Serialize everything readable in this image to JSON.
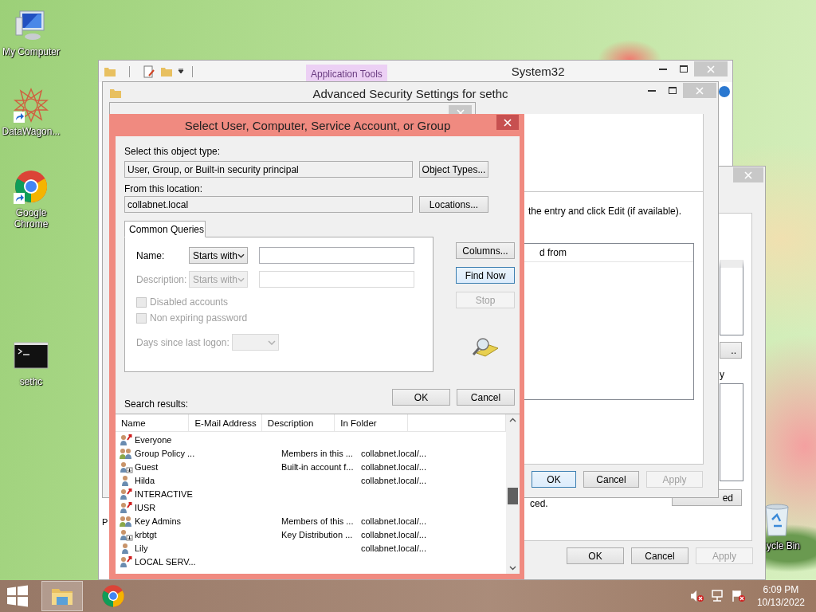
{
  "desktop_icons": [
    {
      "kind": "computer",
      "label": "My Computer",
      "shortcut": false
    },
    {
      "kind": "star",
      "label": "DataWagon...",
      "shortcut": true
    },
    {
      "kind": "chrome",
      "label": "Google Chrome",
      "shortcut": true
    },
    {
      "kind": "console",
      "label": "sethc",
      "shortcut": false
    }
  ],
  "recycle_bin": {
    "label": "ycle Bin"
  },
  "explorer_window": {
    "title": "System32",
    "context_tab": "Application Tools",
    "pane_fragment": "P"
  },
  "advanced_security_window": {
    "title": "Advanced Security Settings for sethc",
    "instruction": "the entry and click Edit (if available).",
    "list_header": "d from",
    "buttons": [
      {
        "label": "OK",
        "default": true,
        "disabled": false
      },
      {
        "label": "Cancel",
        "default": false,
        "disabled": false
      },
      {
        "label": "Apply",
        "default": false,
        "disabled": true
      }
    ]
  },
  "properties_window": {
    "label_fragment": "y",
    "small_button": "..",
    "note": "ced.",
    "advanced_button": "ed",
    "buttons": [
      {
        "label": "OK",
        "default": false,
        "disabled": false
      },
      {
        "label": "Cancel",
        "default": false,
        "disabled": false
      },
      {
        "label": "Apply",
        "default": false,
        "disabled": true
      }
    ]
  },
  "select_dialog": {
    "title": "Select User, Computer, Service Account, or Group",
    "object_type": {
      "label": "Select this object type:",
      "value": "User, Group, or Built-in security principal",
      "button": "Object Types..."
    },
    "location": {
      "label": "From this location:",
      "value": "collabnet.local",
      "button": "Locations..."
    },
    "tab": {
      "label": "Common Queries",
      "selected": true
    },
    "queries": [
      {
        "label": "Name:",
        "operator": "Starts with",
        "disabled": false
      },
      {
        "label": "Description:",
        "operator": "Starts with",
        "disabled": true
      }
    ],
    "checkboxes": [
      {
        "label": "Disabled accounts",
        "checked": false,
        "disabled": true
      },
      {
        "label": "Non expiring password",
        "checked": false,
        "disabled": true
      }
    ],
    "days_since_logon": {
      "label": "Days since last logon:",
      "disabled": true
    },
    "side_buttons": [
      {
        "label": "Columns...",
        "default": false,
        "disabled": false
      },
      {
        "label": "Find Now",
        "default": true,
        "disabled": false
      },
      {
        "label": "Stop",
        "default": false,
        "disabled": true
      }
    ],
    "buttons": [
      {
        "label": "OK",
        "default": false,
        "disabled": false
      },
      {
        "label": "Cancel",
        "default": false,
        "disabled": false
      }
    ],
    "results_label": "Search results:",
    "results": {
      "columns": [
        "Name",
        "E-Mail Address",
        "Description",
        "In Folder"
      ],
      "rows": [
        {
          "kind": "builtin",
          "name": "Everyone"
        },
        {
          "kind": "group",
          "name": "Group Policy ...",
          "description": "Members in this ...",
          "folder": "collabnet.local/..."
        },
        {
          "kind": "disabled_user",
          "name": "Guest",
          "description": "Built-in account f...",
          "folder": "collabnet.local/..."
        },
        {
          "kind": "user",
          "name": "Hilda",
          "folder": "collabnet.local/..."
        },
        {
          "kind": "builtin",
          "name": "INTERACTIVE"
        },
        {
          "kind": "builtin",
          "name": "IUSR"
        },
        {
          "kind": "group",
          "name": "Key Admins",
          "description": "Members of this ...",
          "folder": "collabnet.local/..."
        },
        {
          "kind": "disabled_user",
          "name": "krbtgt",
          "description": "Key Distribution ...",
          "folder": "collabnet.local/..."
        },
        {
          "kind": "user",
          "name": "Lily",
          "folder": "collabnet.local/..."
        },
        {
          "kind": "builtin",
          "name": "LOCAL SERV..."
        }
      ]
    }
  },
  "taskbar": {
    "apps": [
      {
        "kind": "explorer",
        "selected": true
      },
      {
        "kind": "chrome",
        "selected": false
      }
    ],
    "clock": {
      "time": "6:09 PM",
      "date": "10/13/2022"
    }
  }
}
